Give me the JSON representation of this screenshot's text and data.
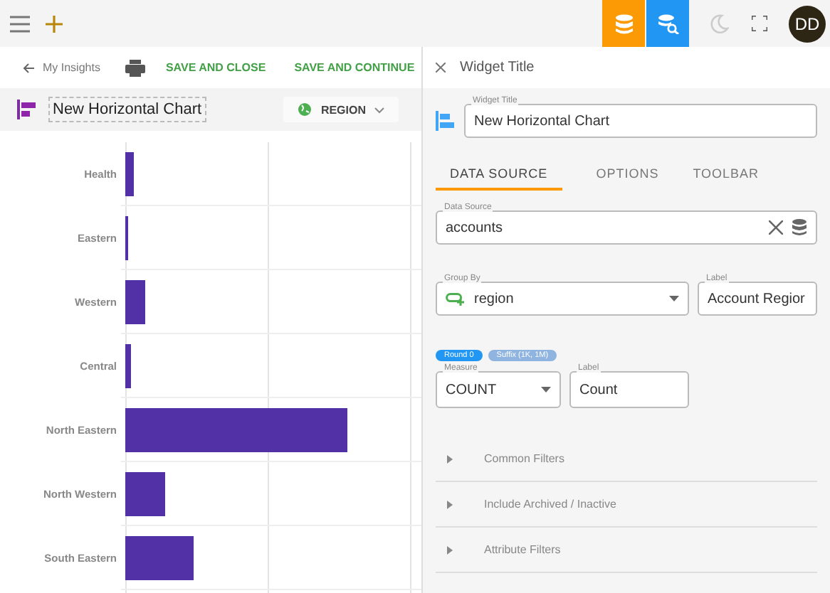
{
  "top_bar": {
    "avatar": "DD"
  },
  "toolbar": {
    "back": "My Insights",
    "actions": [
      "SAVE AND CLOSE",
      "SAVE AND CONTINUE"
    ]
  },
  "chart_header": {
    "title": "New Horizontal Chart",
    "group_button": "REGION"
  },
  "chart_labels": [
    "Health",
    "Eastern",
    "Western",
    "Central",
    "North Eastern",
    "North Western",
    "South Eastern"
  ],
  "panel": {
    "title": "Widget Title",
    "widget_title": {
      "label": "Widget Title",
      "value": "New Horizontal Chart"
    },
    "tabs": [
      {
        "label": "DATA SOURCE",
        "selected": true
      },
      {
        "label": "OPTIONS",
        "selected": false
      },
      {
        "label": "TOOLBAR",
        "selected": false
      }
    ],
    "data_source": {
      "label": "Data Source",
      "value": "accounts"
    },
    "group_by": {
      "label": "Group By",
      "value": "region"
    },
    "group_label": {
      "label": "Label",
      "value": "Account Regior"
    },
    "chips": [
      {
        "label": "Round 0",
        "selected": true
      },
      {
        "label": "Suffix (1K, 1M)",
        "selected": false
      }
    ],
    "measure": {
      "label": "Measure",
      "value": "COUNT"
    },
    "measure_label": {
      "label": "Label",
      "value": "Count"
    },
    "sections": [
      {
        "label": "Common Filters",
        "expanded": false
      },
      {
        "label": "Include Archived / Inactive",
        "expanded": false
      },
      {
        "label": "Attribute Filters",
        "expanded": false
      }
    ]
  }
}
